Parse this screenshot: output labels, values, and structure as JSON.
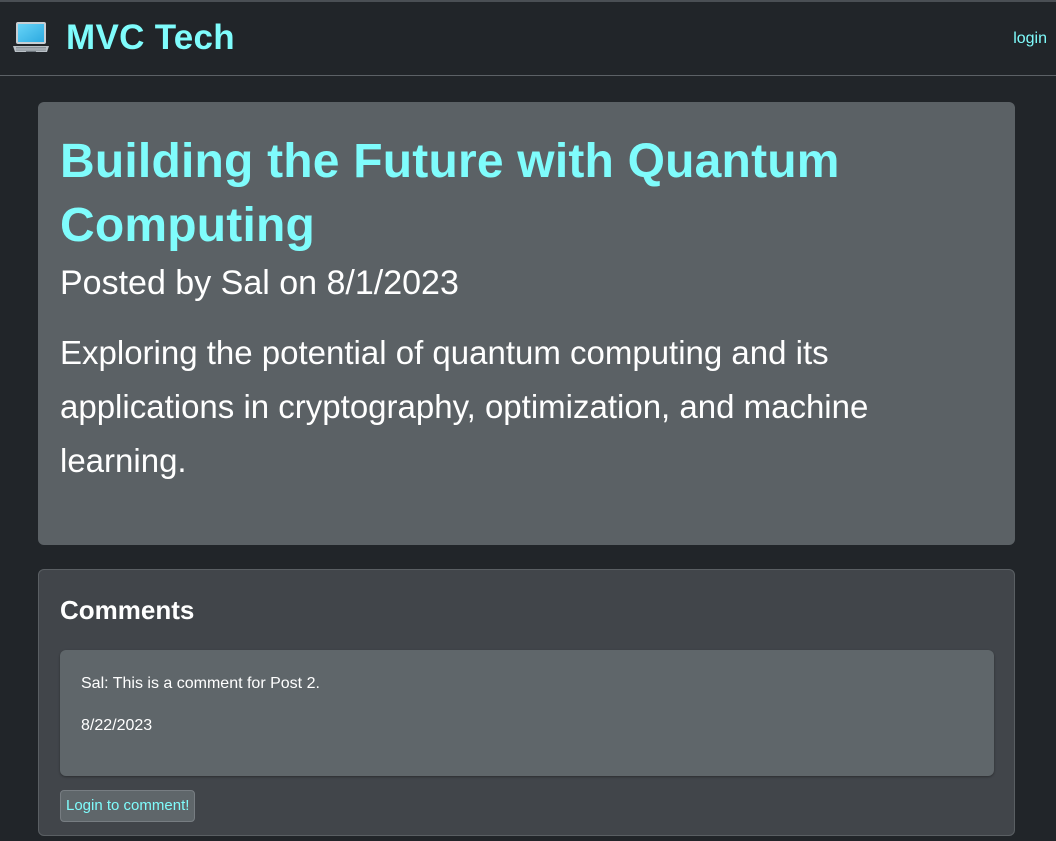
{
  "header": {
    "brand_icon": "laptop-icon",
    "brand_title": "MVC Tech",
    "login_label": "login",
    "accent_color": "#7ffcfc"
  },
  "post": {
    "title": "Building the Future with Quantum Computing",
    "meta": "Posted by Sal on 8/1/2023",
    "body": "Exploring the potential of quantum computing and its applications in cryptography, optimization, and machine learning."
  },
  "comments": {
    "heading": "Comments",
    "items": [
      {
        "text": "Sal: This is a comment for Post 2.",
        "date": "8/22/2023"
      }
    ],
    "login_button_label": "Login to comment!"
  }
}
